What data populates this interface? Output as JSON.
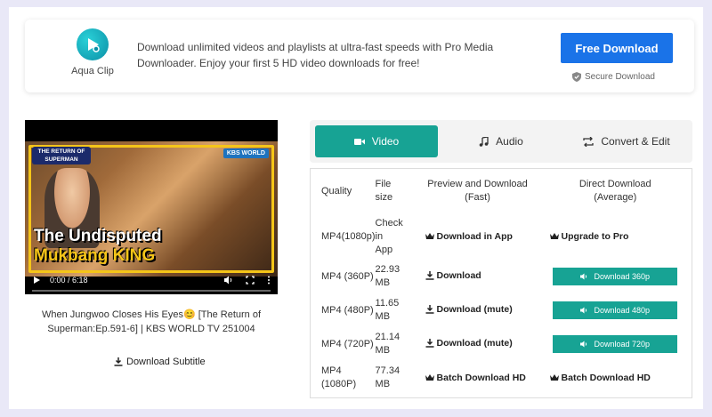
{
  "banner": {
    "logo_text": "Aqua Clip",
    "promo_text": "Download unlimited videos and playlists at ultra-fast speeds with Pro Media Downloader. Enjoy your first 5 HD video downloads for free!",
    "free_download_label": "Free Download",
    "secure_label": "Secure Download"
  },
  "video": {
    "tag_return": "THE RETURN OF SUPERMAN",
    "tag_kbs": "KBS WORLD",
    "headline_line1": "The Undisputed",
    "headline_line2": "Mukbang KING",
    "time": "0:00 / 6:18",
    "title": "When Jungwoo Closes His Eyes😊 [The Return of Superman:Ep.591-6] | KBS WORLD TV 251004",
    "download_subtitle": "Download Subtitle"
  },
  "tabs": [
    {
      "label": "Video",
      "icon": "video-camera-icon",
      "active": true
    },
    {
      "label": "Audio",
      "icon": "music-note-icon",
      "active": false
    },
    {
      "label": "Convert & Edit",
      "icon": "convert-arrows-icon",
      "active": false
    }
  ],
  "table": {
    "headers": {
      "quality": "Quality",
      "file_size_1": "File",
      "file_size_2": "size",
      "preview_1": "Preview and Download",
      "preview_2": "(Fast)",
      "direct_1": "Direct Download",
      "direct_2": "(Average)"
    },
    "rows": [
      {
        "quality": "MP4(1080p)",
        "size": [
          "Check",
          "in",
          "App"
        ],
        "preview": "Download in App",
        "direct": "Upgrade to Pro"
      },
      {
        "quality": "MP4 (360P)",
        "size": [
          "22.93",
          "MB"
        ],
        "preview": "Download",
        "direct": "Download 360p"
      },
      {
        "quality": "MP4 (480P)",
        "size": [
          "11.65",
          "MB"
        ],
        "preview": "Download (mute)",
        "direct": "Download 480p"
      },
      {
        "quality": "MP4 (720P)",
        "size": [
          "21.14",
          "MB"
        ],
        "preview": "Download (mute)",
        "direct": "Download 720p"
      },
      {
        "quality": [
          "MP4",
          "(1080P)"
        ],
        "size": [
          "77.34",
          "MB"
        ],
        "preview": "Batch Download HD",
        "direct": "Batch Download HD"
      }
    ]
  },
  "colors": {
    "accent": "#17a394",
    "brand_button": "#1a73e8",
    "background": "#e9e8f7"
  }
}
